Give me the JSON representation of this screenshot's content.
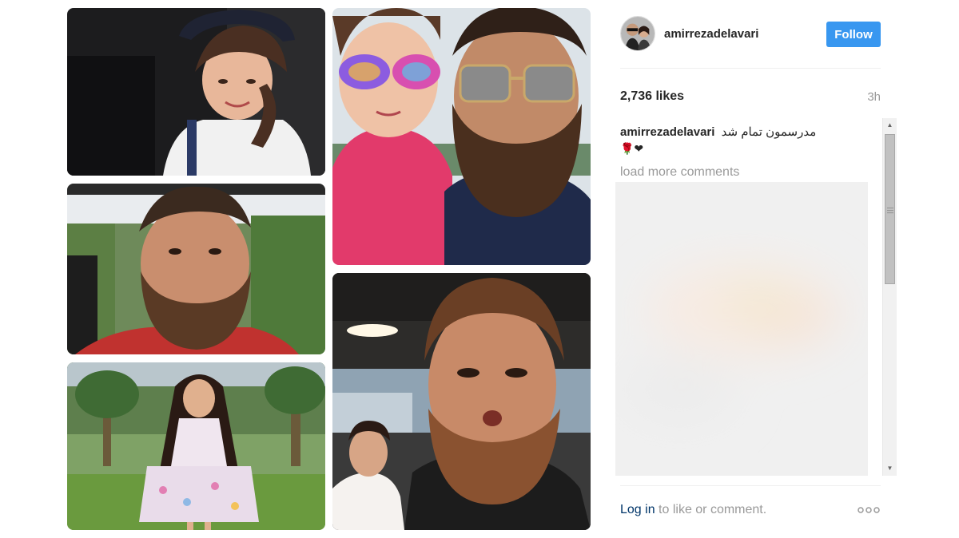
{
  "post": {
    "username": "amirrezadelavari",
    "follow_label": "Follow",
    "likes": "2,736 likes",
    "time": "3h"
  },
  "comments": {
    "caption_user": "amirrezadelavari",
    "caption_text": "مدرسمون تمام شد",
    "caption_emoji": "🌹❤",
    "load_more": "load more comments"
  },
  "footer": {
    "login_link": "Log in",
    "login_rest": " to like or comment."
  },
  "colors": {
    "follow_button": "#3897f0",
    "link": "#003569",
    "muted_text": "#999999"
  },
  "icons": {
    "more_options": "more-options-icon",
    "scroll_up": "scroll-up-arrow-icon",
    "scroll_down": "scroll-down-arrow-icon"
  }
}
